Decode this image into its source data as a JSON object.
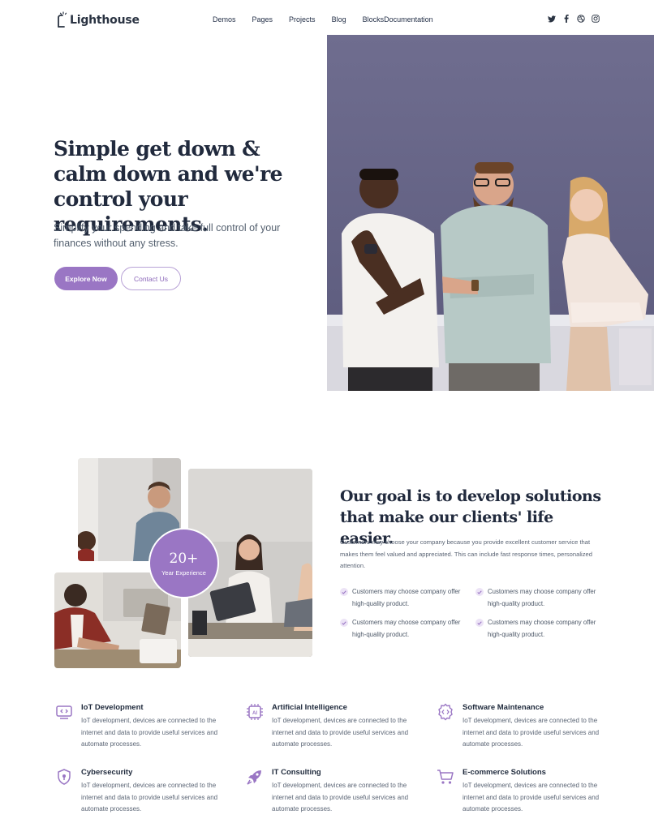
{
  "brand": {
    "name": "Lighthouse",
    "accent": "#9a76c4"
  },
  "nav": {
    "items": [
      {
        "label": "Demos"
      },
      {
        "label": "Pages"
      },
      {
        "label": "Projects"
      },
      {
        "label": "Blog"
      },
      {
        "label": "Blocks"
      },
      {
        "label": "Documentation"
      }
    ]
  },
  "social": [
    "twitter-icon",
    "facebook-icon",
    "dribbble-icon",
    "instagram-icon"
  ],
  "hero": {
    "title": "Simple get down & calm down and we're control your requirements.",
    "subtitle": "Simplify your spending and take full control of your finances without any stress.",
    "primary_cta": "Explore Now",
    "secondary_cta": "Contact Us"
  },
  "about": {
    "experience_number": "20+",
    "experience_label": "Year Experience",
    "title": "Our goal is to develop solutions that make our clients' life easier.",
    "description": "Customers may choose your company because you provide excellent customer service that makes them feel valued and appreciated. This can include fast response times, personalized attention.",
    "checklist": [
      "Customers may choose company offer high-quality product.",
      "Customers may choose company offer high-quality product.",
      "Customers may choose company offer high-quality product.",
      "Customers may choose company offer high-quality product."
    ]
  },
  "services": [
    {
      "icon": "iot-icon",
      "title": "IoT Development",
      "desc": "IoT development, devices are connected to the internet and data to provide useful services and automate processes."
    },
    {
      "icon": "ai-chip-icon",
      "title": "Artificial Intelligence",
      "desc": "IoT development, devices are connected to the internet and data to provide useful services and automate processes."
    },
    {
      "icon": "code-gear-icon",
      "title": "Software Maintenance",
      "desc": "IoT development, devices are connected to the internet and data to provide useful services and automate processes."
    },
    {
      "icon": "shield-icon",
      "title": "Cybersecurity",
      "desc": "IoT development, devices are connected to the internet and data to provide useful services and automate processes."
    },
    {
      "icon": "rocket-icon",
      "title": "IT Consulting",
      "desc": "IoT development, devices are connected to the internet and data to provide useful services and automate processes."
    },
    {
      "icon": "cart-icon",
      "title": "E-commerce Solutions",
      "desc": "IoT development, devices are connected to the internet and data to provide useful services and automate processes."
    }
  ]
}
